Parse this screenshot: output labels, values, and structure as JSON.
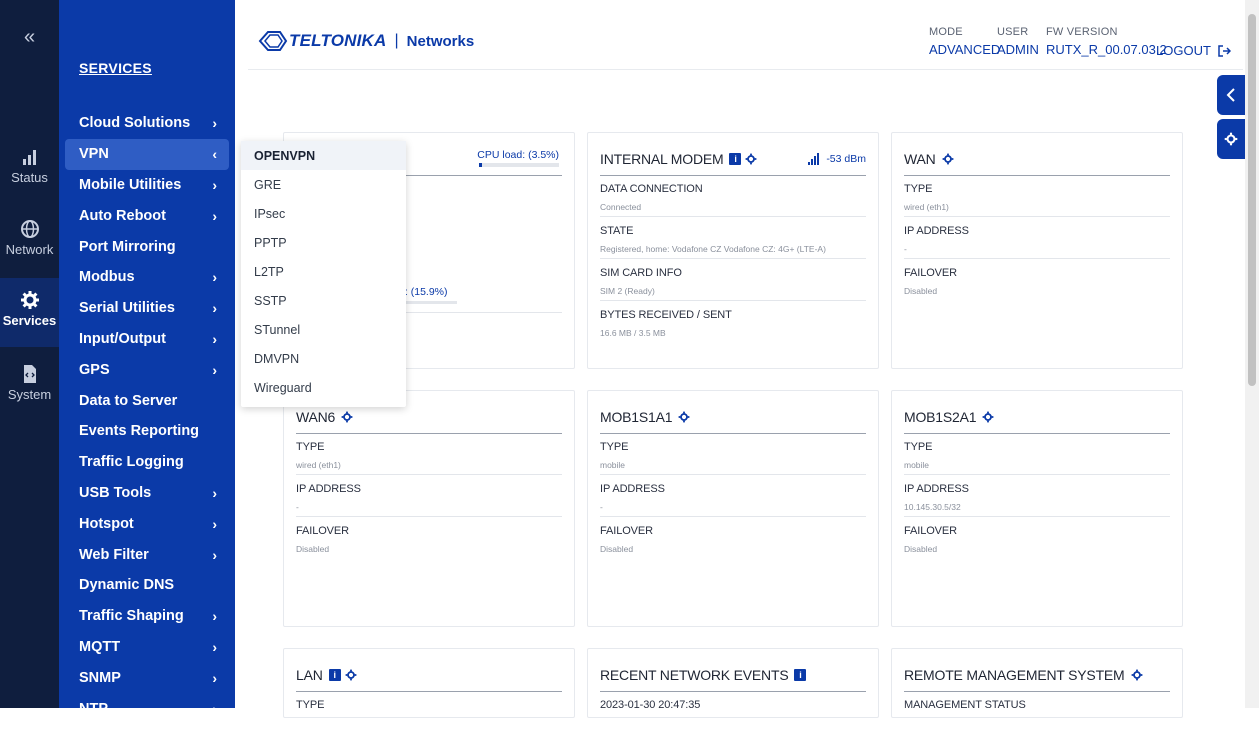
{
  "rail": {
    "collapse": "«",
    "items": [
      {
        "label": "Status",
        "icon": "bar-chart-icon"
      },
      {
        "label": "Network",
        "icon": "globe-icon"
      },
      {
        "label": "Services",
        "icon": "gear-icon"
      },
      {
        "label": "System",
        "icon": "document-code-icon"
      }
    ]
  },
  "menu": {
    "title": "SERVICES",
    "items": [
      {
        "label": "Cloud Solutions",
        "chevron": "›"
      },
      {
        "label": "VPN",
        "chevron": "‹"
      },
      {
        "label": "Mobile Utilities",
        "chevron": "›"
      },
      {
        "label": "Auto Reboot",
        "chevron": "›"
      },
      {
        "label": "Port Mirroring",
        "chevron": ""
      },
      {
        "label": "Modbus",
        "chevron": "›"
      },
      {
        "label": "Serial Utilities",
        "chevron": "›"
      },
      {
        "label": "Input/Output",
        "chevron": "›"
      },
      {
        "label": "GPS",
        "chevron": "›"
      },
      {
        "label": "Data to Server",
        "chevron": ""
      },
      {
        "label": "Events Reporting",
        "chevron": ""
      },
      {
        "label": "Traffic Logging",
        "chevron": ""
      },
      {
        "label": "USB Tools",
        "chevron": "›"
      },
      {
        "label": "Hotspot",
        "chevron": "›"
      },
      {
        "label": "Web Filter",
        "chevron": "›"
      },
      {
        "label": "Dynamic DNS",
        "chevron": ""
      },
      {
        "label": "Traffic Shaping",
        "chevron": "›"
      },
      {
        "label": "MQTT",
        "chevron": "›"
      },
      {
        "label": "SNMP",
        "chevron": "›"
      },
      {
        "label": "NTP",
        "chevron": "›"
      }
    ]
  },
  "vpn_dropdown": [
    "OPENVPN",
    "GRE",
    "IPsec",
    "PPTP",
    "L2TP",
    "SSTP",
    "STunnel",
    "DMVPN",
    "Wireguard"
  ],
  "header": {
    "brand": "TELTONIKA",
    "sub": "Networks",
    "mode_label": "MODE",
    "mode_value": "ADVANCED",
    "user_label": "USER",
    "user_value": "ADMIN",
    "fw_label": "FW VERSION",
    "fw_value": "RUTX_R_00.07.03.2",
    "logout": "LOGOUT"
  },
  "system_card": {
    "cpu_load": "CPU load: (3.5%)",
    "cpu_fraction": 0.035,
    "ram_partial": "I: (15.9%)"
  },
  "cards": {
    "internal_modem": {
      "title": "INTERNAL MODEM",
      "signal": "-53 dBm",
      "rows": [
        {
          "label": "DATA CONNECTION",
          "value": "Connected"
        },
        {
          "label": "STATE",
          "value": "Registered, home: Vodafone CZ Vodafone CZ: 4G+ (LTE-A)"
        },
        {
          "label": "SIM CARD INFO",
          "value": "SIM 2 (Ready)"
        },
        {
          "label": "BYTES RECEIVED / SENT",
          "value": "16.6 MB / 3.5 MB"
        }
      ]
    },
    "wan": {
      "title": "WAN",
      "rows": [
        {
          "label": "TYPE",
          "value": "wired (eth1)"
        },
        {
          "label": "IP ADDRESS",
          "value": "-"
        },
        {
          "label": "FAILOVER",
          "value": "Disabled"
        }
      ]
    },
    "wan6": {
      "title": "WAN6",
      "rows": [
        {
          "label": "TYPE",
          "value": "wired (eth1)"
        },
        {
          "label": "IP ADDRESS",
          "value": "-"
        },
        {
          "label": "FAILOVER",
          "value": "Disabled"
        }
      ]
    },
    "mob1s1a1": {
      "title": "MOB1S1A1",
      "rows": [
        {
          "label": "TYPE",
          "value": "mobile"
        },
        {
          "label": "IP ADDRESS",
          "value": "-"
        },
        {
          "label": "FAILOVER",
          "value": "Disabled"
        }
      ]
    },
    "mob1s2a1": {
      "title": "MOB1S2A1",
      "rows": [
        {
          "label": "TYPE",
          "value": "mobile"
        },
        {
          "label": "IP ADDRESS",
          "value": "10.145.30.5/32"
        },
        {
          "label": "FAILOVER",
          "value": "Disabled"
        }
      ]
    },
    "lan": {
      "title": "LAN",
      "row_label": "TYPE"
    },
    "recent_events": {
      "title": "RECENT NETWORK EVENTS",
      "row_label": "2023-01-30 20:47:35"
    },
    "rms": {
      "title": "REMOTE MANAGEMENT SYSTEM",
      "row_label": "MANAGEMENT STATUS"
    }
  },
  "colors": {
    "brand": "#0b3aa8",
    "rail": "#0f1e3e"
  }
}
